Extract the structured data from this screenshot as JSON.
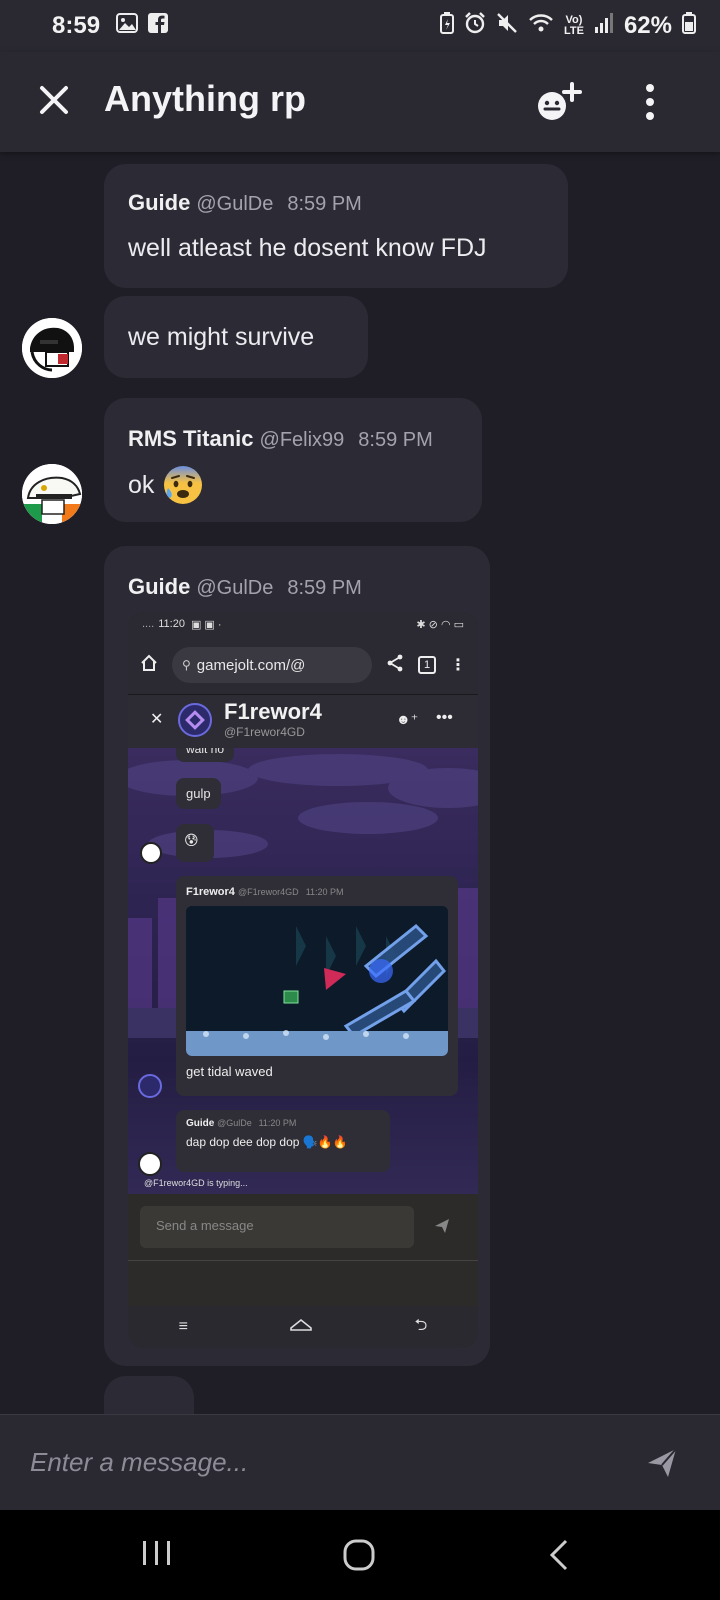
{
  "status_bar": {
    "time": "8:59",
    "network_labels": [
      "Vo)",
      "LTE"
    ],
    "battery": "62%"
  },
  "header": {
    "title": "Anything rp",
    "icons": [
      "close-icon",
      "emoji-add-icon",
      "more-vertical-icon"
    ]
  },
  "messages": [
    {
      "user": "Guide",
      "handle": "@GulDe",
      "time": "8:59 PM",
      "text": "well atleast he dosent know FDJ"
    },
    {
      "text": "we might survive"
    },
    {
      "user": "RMS Titanic",
      "handle": "@Felix99",
      "time": "8:59 PM",
      "text": "ok",
      "emoji": "😰"
    },
    {
      "user": "Guide",
      "handle": "@GulDe",
      "time": "8:59 PM",
      "attachment": "screenshot"
    }
  ],
  "embedded": {
    "status_time": "11:20",
    "url": "gamejolt.com/@",
    "tab_count": "1",
    "chat_title": "F1rewor4",
    "chat_handle": "@F1rewor4GD",
    "msg_partial": "wait no",
    "msg_gulp": "gulp",
    "msg_emoji": "😰",
    "post_user": "F1rewor4",
    "post_handle": "@F1rewor4GD",
    "post_time": "11:20 PM",
    "post_caption": "get tidal waved",
    "reply_user": "Guide",
    "reply_handle": "@GulDe",
    "reply_time": "11:20 PM",
    "reply_text": "dap dop dee dop dop 🗣️🔥🔥",
    "typing": "@F1rewor4GD is typing...",
    "input_placeholder": "Send a message"
  },
  "composer": {
    "placeholder": "Enter a message..."
  },
  "colors": {
    "background": "#1f1e27",
    "bubble": "#2c2b35",
    "header": "#2a2932",
    "muted_text": "#a3a2ad"
  }
}
